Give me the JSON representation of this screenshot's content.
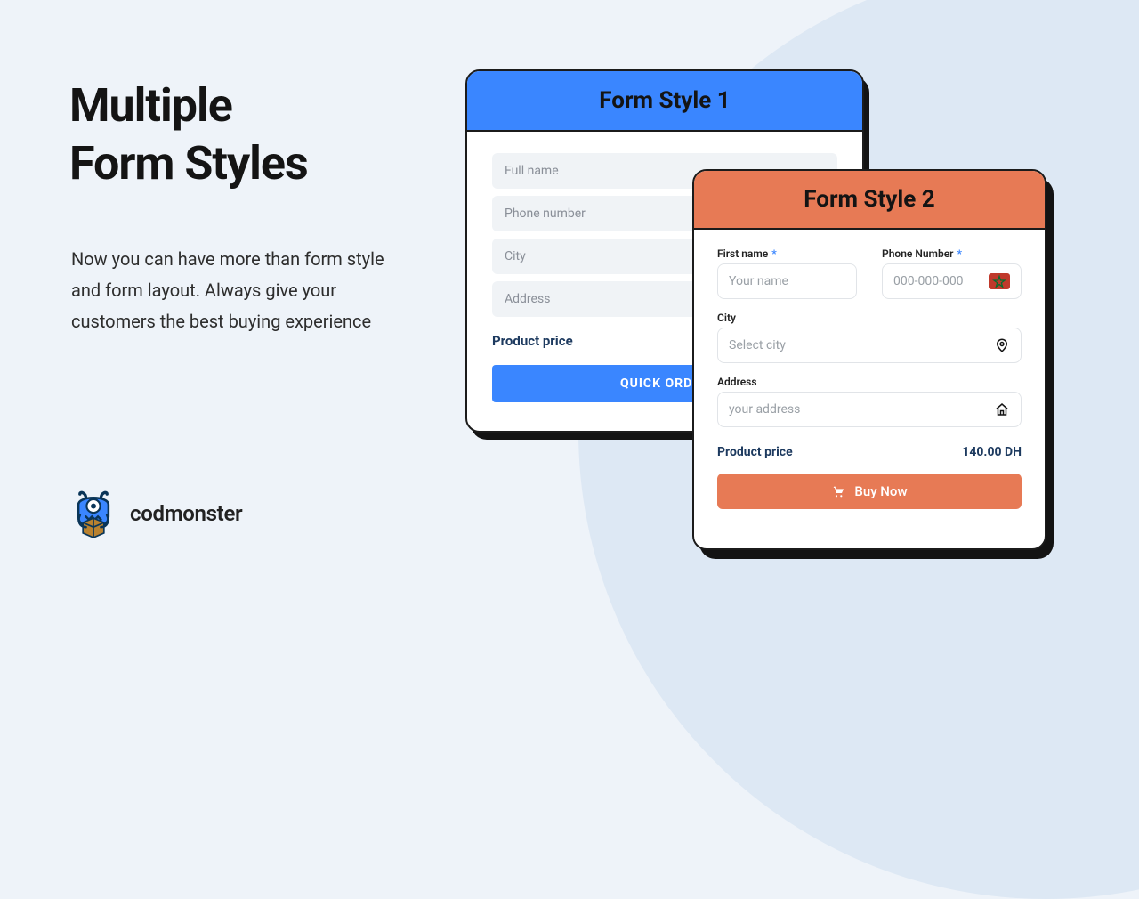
{
  "headline_l1": "Multiple",
  "headline_l2": "Form Styles",
  "subhead": "Now you can have more than form style and form layout. Always give your customers the best buying experience",
  "brand": {
    "name": "codmonster"
  },
  "card1": {
    "title": "Form Style 1",
    "fields": {
      "fullname_ph": "Full name",
      "phone_ph": "Phone number",
      "city_ph": "City",
      "address_ph": "Address"
    },
    "price_label": "Product price",
    "cta_label": "QUICK ORDER"
  },
  "card2": {
    "title": "Form Style 2",
    "firstname_label": "First name",
    "firstname_ph": "Your name",
    "phone_label": "Phone Number",
    "phone_ph": "000-000-000",
    "city_label": "City",
    "city_ph": "Select city",
    "address_label": "Address",
    "address_ph": "your address",
    "price_label": "Product price",
    "price_value": "140.00 DH",
    "buy_label": "Buy Now",
    "flag_country": "Morocco"
  }
}
